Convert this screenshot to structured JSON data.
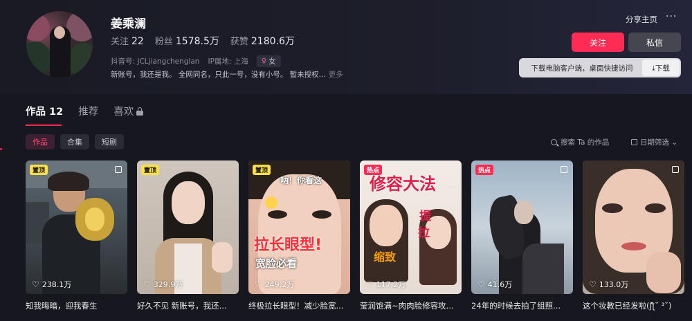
{
  "profile": {
    "name": "姜乘澜",
    "stats": [
      {
        "label": "关注",
        "value": "22"
      },
      {
        "label": "粉丝",
        "value": "1578.5万"
      },
      {
        "label": "获赞",
        "value": "2180.6万"
      }
    ],
    "douyin_id": "抖音号: JCLjiangchenglan",
    "ip": "IP属地: 上海",
    "gender": "女",
    "bio": "新账号，我还是我。 全网同名，只此一号，没有小号。 暂未授权...",
    "bio_more": "更多"
  },
  "actions": {
    "share": "分享主页",
    "more": "···",
    "follow": "关注",
    "message": "私信",
    "download_text": "下载电脑客户端，桌面快捷访问",
    "download_btn": "⤓下载"
  },
  "tabs": [
    {
      "label": "作品 12"
    },
    {
      "label": "推荐"
    },
    {
      "label": "喜欢"
    }
  ],
  "chips": [
    "作品",
    "合集",
    "短剧"
  ],
  "tools": {
    "search": "搜索 Ta 的作品",
    "date_filter": "日期筛选 ⌄"
  },
  "colors": {
    "accent": "#fe2c55",
    "pin_tag": "#fde047"
  },
  "videos": [
    {
      "tag": "置顶",
      "likes": "238.1万",
      "title": "知我晦暗，迎我春生",
      "multi": true
    },
    {
      "tag": "置顶",
      "likes": "329.9万",
      "title": "好久不见 新账号，我还...",
      "multi": false
    },
    {
      "tag": "置顶",
      "likes": "249.2万",
      "title": "终极拉长眼型！减少脸宽...",
      "multi": false,
      "overlay": [
        "呐！你看这",
        "拉长眼型!",
        "宽脸必看"
      ]
    },
    {
      "tag": "热点",
      "likes": "117.2万",
      "title": "莹润饱满~肉肉脸修容攻...",
      "multi": false,
      "overlay": [
        "修容大法",
        "提",
        "拉",
        "缩致"
      ]
    },
    {
      "tag": "热点",
      "likes": "41.6万",
      "title": "24年的时候去拍了组照...",
      "multi": true
    },
    {
      "tag": "",
      "likes": "133.0万",
      "title": "这个妆教已经发啦(ʃƪ˘ ³˘)",
      "multi": true
    }
  ]
}
